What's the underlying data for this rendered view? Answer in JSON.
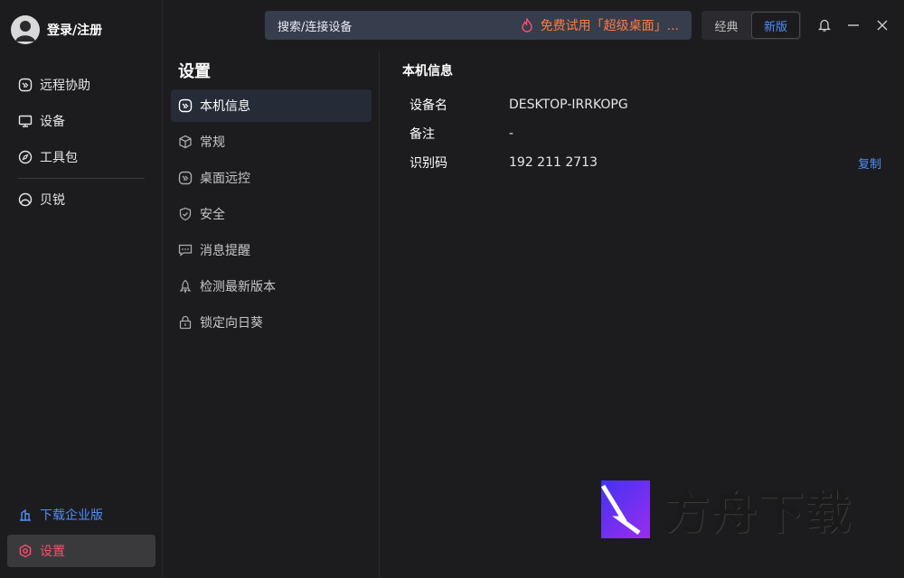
{
  "user": {
    "label": "登录/注册",
    "avatar_icon": "user-avatar-icon"
  },
  "sidebar": {
    "items": [
      {
        "label": "远程协助",
        "icon": "remote-icon"
      },
      {
        "label": "设备",
        "icon": "monitor-icon"
      },
      {
        "label": "工具包",
        "icon": "compass-icon"
      },
      {
        "label": "贝锐",
        "icon": "beirui-icon"
      }
    ],
    "download_enterprise": "下载企业版",
    "settings": "设置"
  },
  "topbar": {
    "search_placeholder": "搜索/连接设备",
    "promo": "免费试用「超级桌面」...",
    "mode_classic": "经典",
    "mode_new": "新版"
  },
  "settings_nav": {
    "title": "设置",
    "items": [
      {
        "label": "本机信息",
        "icon": "remote-icon",
        "active": true
      },
      {
        "label": "常规",
        "icon": "cube-icon"
      },
      {
        "label": "桌面远控",
        "icon": "remote-icon"
      },
      {
        "label": "安全",
        "icon": "shield-icon"
      },
      {
        "label": "消息提醒",
        "icon": "message-icon"
      },
      {
        "label": "检测最新版本",
        "icon": "rocket-icon"
      },
      {
        "label": "锁定向日葵",
        "icon": "lock-icon"
      }
    ]
  },
  "device_info": {
    "title": "本机信息",
    "name_label": "设备名",
    "name_value": "DESKTOP-IRRKOPG",
    "note_label": "备注",
    "note_value": "-",
    "id_label": "识别码",
    "id_value": "192 211 2713",
    "copy_label": "复制"
  },
  "watermark": {
    "text": "方舟下载"
  },
  "colors": {
    "accent_blue": "#4f8ef7",
    "promo_orange": "#ff7a3d",
    "settings_red": "#ff4d6a",
    "background": "#1c1c1f"
  }
}
